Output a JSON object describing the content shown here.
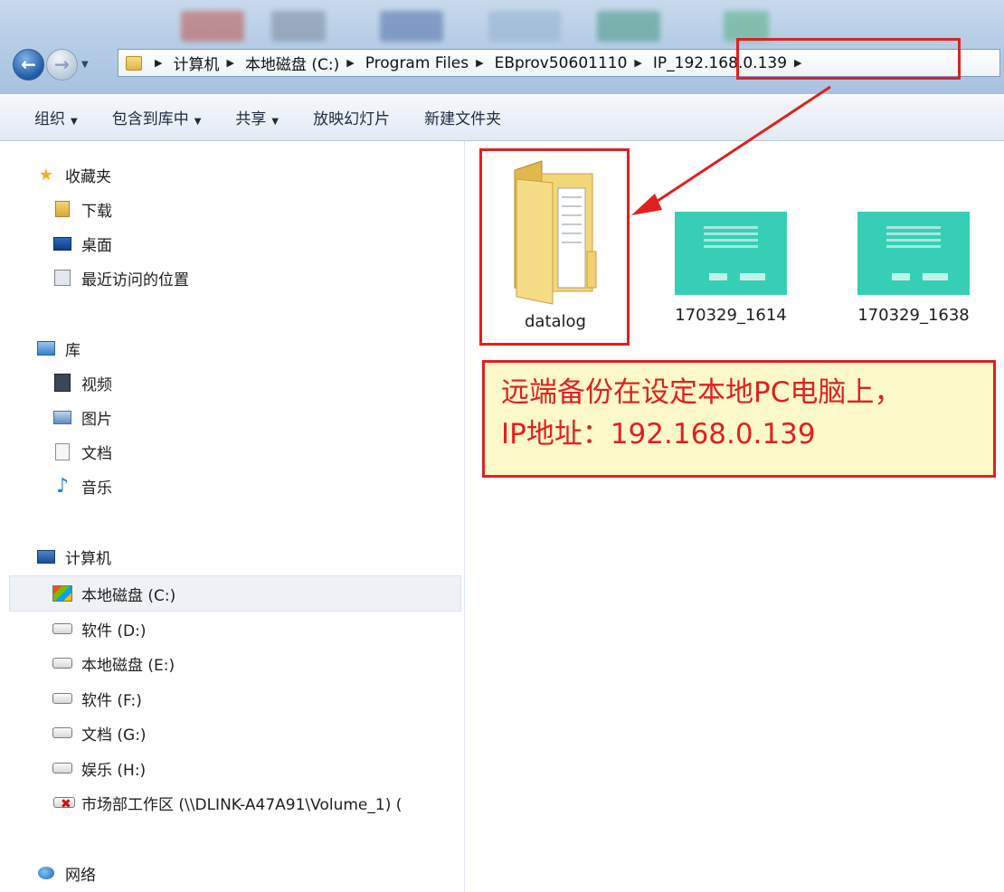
{
  "address": {
    "breadcrumbs": [
      "计算机",
      "本地磁盘 (C:)",
      "Program Files",
      "EBprov50601110",
      "IP_192.168.0.139"
    ]
  },
  "toolbar": {
    "organize": "组织",
    "include_in_library": "包含到库中",
    "share": "共享",
    "slideshow": "放映幻灯片",
    "new_folder": "新建文件夹"
  },
  "nav": {
    "favorites": "收藏夹",
    "downloads": "下载",
    "desktop": "桌面",
    "recent": "最近访问的位置",
    "libraries": "库",
    "videos": "视频",
    "pictures": "图片",
    "documents": "文档",
    "music": "音乐",
    "computer": "计算机",
    "drive_c": "本地磁盘 (C:)",
    "drive_d": "软件 (D:)",
    "drive_e": "本地磁盘 (E:)",
    "drive_f": "软件 (F:)",
    "drive_g": "文档 (G:)",
    "drive_h": "娱乐 (H:)",
    "network_drive": "市场部工作区 (\\\\DLINK-A47A91\\Volume_1) (",
    "network": "网络"
  },
  "files": [
    {
      "name": "datalog",
      "type": "folder"
    },
    {
      "name": "170329_1614",
      "type": "image"
    },
    {
      "name": "170329_1638",
      "type": "image"
    }
  ],
  "callout": {
    "line1": "远端备份在设定本地PC电脑上，",
    "line2": "IP地址：192.168.0.139"
  },
  "colors": {
    "annotation_red": "#e02020",
    "callout_bg": "#fdf9c8",
    "thumbnail_teal": "#36cfb5"
  }
}
